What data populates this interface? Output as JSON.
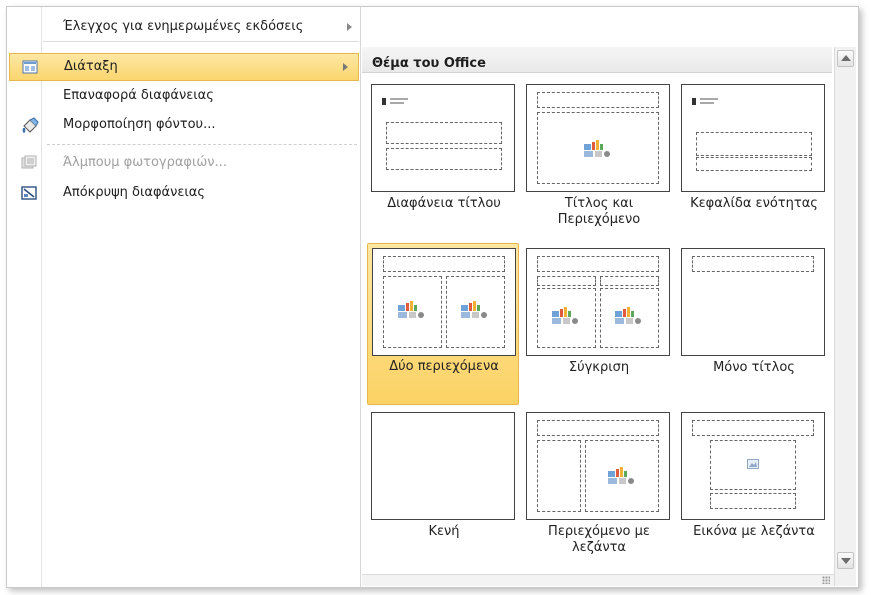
{
  "menu": {
    "top_item": {
      "label": "Έλεγχος για ενημερωμένες εκδόσεις"
    },
    "items": [
      {
        "label": "Διάταξη",
        "icon": "layout-icon",
        "selected": true,
        "submenu": true,
        "disabled": false
      },
      {
        "label": "Επαναφορά διαφάνειας",
        "icon": "",
        "selected": false,
        "submenu": false,
        "disabled": false
      },
      {
        "label": "Μορφοποίηση φόντου...",
        "icon": "format-background-icon",
        "selected": false,
        "submenu": false,
        "disabled": false
      },
      {
        "label": "Άλμπουμ φωτογραφιών...",
        "icon": "photo-album-icon",
        "selected": false,
        "submenu": false,
        "disabled": true
      },
      {
        "label": "Απόκρυψη διαφάνειας",
        "icon": "hide-slide-icon",
        "selected": false,
        "submenu": false,
        "disabled": false
      }
    ]
  },
  "gallery": {
    "header": "Θέμα του Office",
    "layouts": [
      {
        "name": "Διαφάνεια τίτλου",
        "selected": false
      },
      {
        "name": "Τίτλος και Περιεχόμενο",
        "selected": false
      },
      {
        "name": "Κεφαλίδα ενότητας",
        "selected": false
      },
      {
        "name": "Δύο περιεχόμενα",
        "selected": true
      },
      {
        "name": "Σύγκριση",
        "selected": false
      },
      {
        "name": "Μόνο τίτλος",
        "selected": false
      },
      {
        "name": "Κενή",
        "selected": false
      },
      {
        "name": "Περιεχόμενο με λεζάντα",
        "selected": false
      },
      {
        "name": "Εικόνα με λεζάντα",
        "selected": false
      }
    ]
  },
  "colors": {
    "selection_fill": "#fbd66e",
    "selection_border": "#e9b84b"
  }
}
